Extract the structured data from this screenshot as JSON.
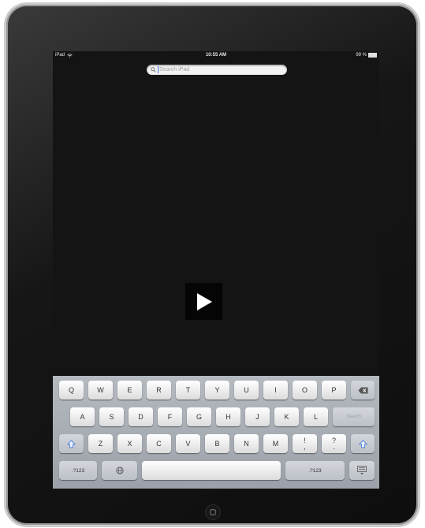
{
  "status": {
    "device": "iPad",
    "time": "10:55 AM",
    "battery": "99 %"
  },
  "search": {
    "placeholder": "Search iPad"
  },
  "video": {
    "play_icon": "play-icon"
  },
  "keyboard": {
    "row1": [
      "Q",
      "W",
      "E",
      "R",
      "T",
      "Y",
      "U",
      "I",
      "O",
      "P"
    ],
    "row2": [
      "A",
      "S",
      "D",
      "F",
      "G",
      "H",
      "J",
      "K",
      "L"
    ],
    "row3": [
      "Z",
      "X",
      "C",
      "V",
      "B",
      "N",
      "M"
    ],
    "excl": [
      "!",
      ","
    ],
    "quest": [
      "?",
      "."
    ],
    "search_key": "Search",
    "numbers_key": ".?123",
    "icons": {
      "backspace": "backspace-icon",
      "shift": "shift-icon",
      "globe": "globe-icon",
      "hide": "hide-keyboard-icon"
    }
  }
}
